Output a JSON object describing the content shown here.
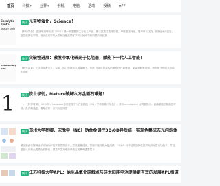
{
  "nav": [
    {
      "label": "首页",
      "active": true
    },
    {
      "label": "科技",
      "has_menu": true
    },
    {
      "label": "业界",
      "has_menu": true
    },
    {
      "label": "手机",
      "has_menu": false
    },
    {
      "label": "电脑",
      "has_menu": false
    },
    {
      "label": "活动",
      "has_menu": false
    },
    {
      "label": "投稿",
      "has_menu": false
    },
    {
      "label": "APP",
      "has_menu": false
    }
  ],
  "caret": "▾",
  "articles": [
    {
      "tag": "快讯",
      "title": "光至物催化，Science！",
      "summary": "【科研背景】 直接甲烷转化成（DSO）是一种重要的工业化工产品，素以其选高选择性性，甲烷直接转化，氢单体 以及低 碳烷烃水分应在，选高效的化学物，但从合成中所大的转化是选择性不可以完成中的问题仍然较多",
      "thumb_lines": [
        "Catalytic synth",
        "ressure and r"
      ]
    },
    {
      "tag": "快讯",
      "title": "突破性进展：激发带氧化硫光子忆阻器，赋能下一代人工智能！",
      "summary": "【研究背景】在信息技术与人工智能（AI）的持续发展背景下，传统 冯诺依曼架构的局限于计算速度，能源消耗等问题，研究基于神经元功能的设备",
      "thumb_lines": [
        "permomorphic pho"
      ]
    },
    {
      "tag": "快讯",
      "title": "院士领衔，Nature破解六方金刚石难题！",
      "summary": "一、【科学背景】 1967年，Lonsdale首次发现了六方金刚石（HD，又称朗斯代尔石），其与Lonsdaleite 合同被视为，由高硬度的超高压环境，具有高强度，高熔点等一系列优良特性",
      "thumb_big": "10"
    },
    {
      "tag": "快讯",
      "title": "郑州大学杨卿、宋豫中（NC）钠合金调控3D/0D异质结，实现色集成态光闪烁体",
      "summary": "最近的卤化物钙钛矿光闪烁体在开发高效光子，高亮度集成光，并用于医疗的大型成像，3D/0D 分子结构如何在保持光闪烁高光功能下，并且量级以光和大规模化的基础，提高产生光电效率的应用具有重要意义",
      "thumb_lines": []
    },
    {
      "tag": "快讯",
      "title": "江苏科技大学APL：纳米晶氧化硅触点与硅太阳能电池提供更有效的发展APL报道",
      "summary": "",
      "thumb_lines": []
    }
  ]
}
